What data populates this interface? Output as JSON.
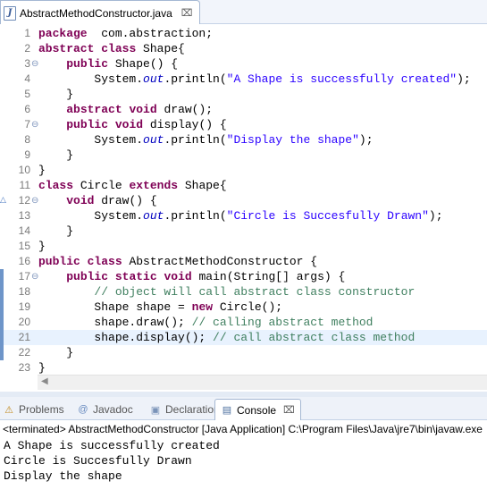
{
  "editor_tab": {
    "icon": "java-file-icon",
    "title": "AbstractMethodConstructor.java",
    "close_glyph": "⌧"
  },
  "code_lines": [
    {
      "num": "1",
      "marker": "",
      "tokens": [
        [
          "kw",
          "package"
        ],
        [
          "",
          "  com.abstraction;"
        ]
      ]
    },
    {
      "num": "2",
      "marker": "",
      "tokens": [
        [
          "kw",
          "abstract"
        ],
        [
          "",
          " "
        ],
        [
          "kw",
          "class"
        ],
        [
          "",
          " Shape{"
        ]
      ]
    },
    {
      "num": "3",
      "marker": "fold",
      "tokens": [
        [
          "",
          "    "
        ],
        [
          "kw",
          "public"
        ],
        [
          "",
          " Shape() {"
        ]
      ]
    },
    {
      "num": "4",
      "marker": "",
      "tokens": [
        [
          "",
          "        System."
        ],
        [
          "fld",
          "out"
        ],
        [
          "",
          ".println("
        ],
        [
          "str",
          "\"A Shape is successfully created\""
        ],
        [
          "",
          ");"
        ]
      ]
    },
    {
      "num": "5",
      "marker": "",
      "tokens": [
        [
          "",
          "    }"
        ]
      ]
    },
    {
      "num": "6",
      "marker": "",
      "tokens": [
        [
          "",
          "    "
        ],
        [
          "kw",
          "abstract"
        ],
        [
          "",
          " "
        ],
        [
          "kw",
          "void"
        ],
        [
          "",
          " draw();"
        ]
      ]
    },
    {
      "num": "7",
      "marker": "fold",
      "tokens": [
        [
          "",
          "    "
        ],
        [
          "kw",
          "public"
        ],
        [
          "",
          " "
        ],
        [
          "kw",
          "void"
        ],
        [
          "",
          " display() {"
        ]
      ]
    },
    {
      "num": "8",
      "marker": "",
      "tokens": [
        [
          "",
          "        System."
        ],
        [
          "fld",
          "out"
        ],
        [
          "",
          ".println("
        ],
        [
          "str",
          "\"Display the shape\""
        ],
        [
          "",
          ");"
        ]
      ]
    },
    {
      "num": "9",
      "marker": "",
      "tokens": [
        [
          "",
          "    }"
        ]
      ]
    },
    {
      "num": "10",
      "marker": "",
      "tokens": [
        [
          "",
          "}"
        ]
      ]
    },
    {
      "num": "11",
      "marker": "",
      "tokens": [
        [
          "kw",
          "class"
        ],
        [
          "",
          " Circle "
        ],
        [
          "kw",
          "extends"
        ],
        [
          "",
          " Shape{"
        ]
      ]
    },
    {
      "num": "12",
      "marker": "override-fold",
      "tokens": [
        [
          "",
          "    "
        ],
        [
          "kw",
          "void"
        ],
        [
          "",
          " draw() {"
        ]
      ]
    },
    {
      "num": "13",
      "marker": "",
      "tokens": [
        [
          "",
          "        System."
        ],
        [
          "fld",
          "out"
        ],
        [
          "",
          ".println("
        ],
        [
          "str",
          "\"Circle is Succesfully Drawn\""
        ],
        [
          "",
          ");"
        ]
      ]
    },
    {
      "num": "14",
      "marker": "",
      "tokens": [
        [
          "",
          "    }"
        ]
      ]
    },
    {
      "num": "15",
      "marker": "",
      "tokens": [
        [
          "",
          "}"
        ]
      ]
    },
    {
      "num": "16",
      "marker": "",
      "tokens": [
        [
          "kw",
          "public"
        ],
        [
          "",
          " "
        ],
        [
          "kw",
          "class"
        ],
        [
          "",
          " AbstractMethodConstructor {"
        ]
      ]
    },
    {
      "num": "17",
      "marker": "fold-range",
      "tokens": [
        [
          "",
          "    "
        ],
        [
          "kw",
          "public"
        ],
        [
          "",
          " "
        ],
        [
          "kw",
          "static"
        ],
        [
          "",
          " "
        ],
        [
          "kw",
          "void"
        ],
        [
          "",
          " main(String[] args) {"
        ]
      ]
    },
    {
      "num": "18",
      "marker": "range",
      "tokens": [
        [
          "",
          "        "
        ],
        [
          "cmt",
          "// object will call abstract class constructor"
        ]
      ]
    },
    {
      "num": "19",
      "marker": "range",
      "tokens": [
        [
          "",
          "        Shape shape = "
        ],
        [
          "kw",
          "new"
        ],
        [
          "",
          " Circle();"
        ]
      ]
    },
    {
      "num": "20",
      "marker": "range",
      "tokens": [
        [
          "",
          "        shape.draw(); "
        ],
        [
          "cmt",
          "// calling abstract method"
        ]
      ]
    },
    {
      "num": "21",
      "marker": "range-current",
      "tokens": [
        [
          "",
          "        shape.display(); "
        ],
        [
          "cmt",
          "// call abstract class method"
        ]
      ]
    },
    {
      "num": "22",
      "marker": "range",
      "tokens": [
        [
          "",
          "    }"
        ]
      ]
    },
    {
      "num": "23",
      "marker": "",
      "tokens": [
        [
          "",
          "}"
        ]
      ]
    }
  ],
  "view_tabs": [
    {
      "id": "problems",
      "label": "Problems",
      "icon": "problems-icon",
      "glyph": "⚠",
      "active": false
    },
    {
      "id": "javadoc",
      "label": "Javadoc",
      "icon": "javadoc-icon",
      "glyph": "@",
      "active": false
    },
    {
      "id": "declaration",
      "label": "Declaration",
      "icon": "declaration-icon",
      "glyph": "▣",
      "active": false
    },
    {
      "id": "console",
      "label": "Console",
      "icon": "console-icon",
      "glyph": "▤",
      "active": true
    }
  ],
  "console": {
    "header": "<terminated> AbstractMethodConstructor [Java Application] C:\\Program Files\\Java\\jre7\\bin\\javaw.exe",
    "output": [
      "A Shape is successfully created",
      "Circle is Succesfully Drawn",
      "Display the shape"
    ]
  },
  "colors": {
    "keyword": "#7f0055",
    "string": "#2a00ff",
    "comment": "#3f7f5f",
    "field": "#0000c0",
    "current_line": "#e8f2fe"
  }
}
